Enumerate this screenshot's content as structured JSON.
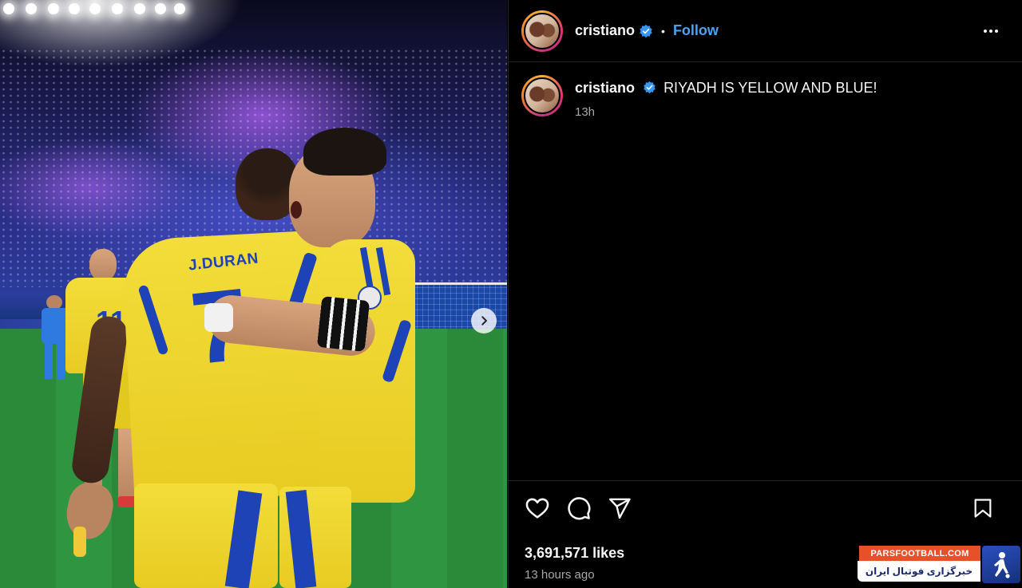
{
  "post": {
    "username": "cristiano",
    "follow_label": "Follow",
    "separator": "•",
    "caption": "RIYADH IS YELLOW AND BLUE!",
    "caption_age": "13h",
    "likes": "3,691,571 likes",
    "posted": "13 hours ago"
  },
  "media": {
    "jersey_name": "J.DURAN",
    "jersey_number_front": "7",
    "jersey_number_bg": "11"
  },
  "icons": {
    "verified": "verified-badge-icon",
    "more": "more-options-icon",
    "like": "heart-icon",
    "comment": "comment-icon",
    "share": "share-icon",
    "save": "bookmark-icon",
    "next": "chevron-right-icon"
  },
  "watermark": {
    "site": "PARSFOOTBALL.COM",
    "tagline": "خبرگزاری فوتبال ایران"
  },
  "colors": {
    "follow": "#4aa3f5",
    "verified": "#3797f0",
    "jersey_yellow": "#f3dd3a",
    "jersey_blue": "#1d43b6",
    "watermark_orange": "#e8502a"
  }
}
